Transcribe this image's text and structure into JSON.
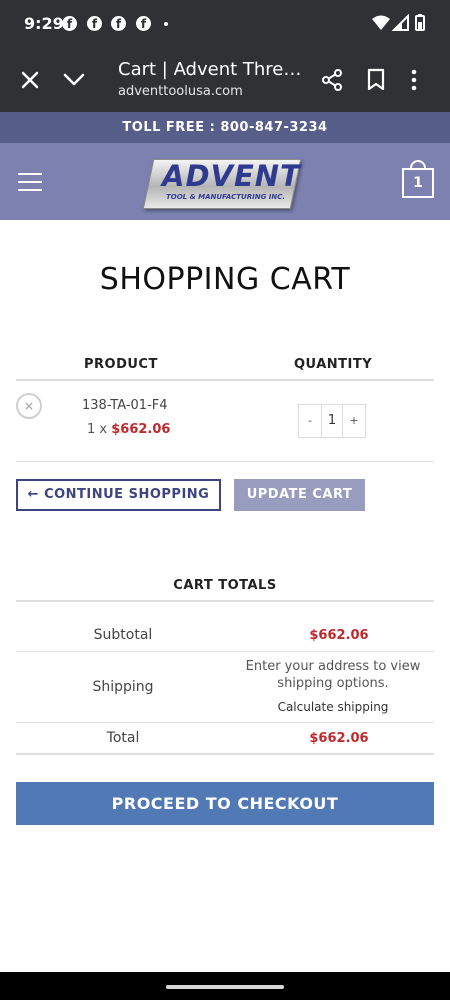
{
  "status_bar": {
    "time": "9:29",
    "notification_icons": [
      "facebook-icon",
      "facebook-icon",
      "facebook-icon",
      "facebook-icon"
    ],
    "system_icons": [
      "wifi-icon",
      "signal-icon",
      "battery-icon"
    ]
  },
  "browser": {
    "page_title": "Cart | Advent Thre…",
    "url": "adventtoolusa.com"
  },
  "site": {
    "toll_free": "TOLL FREE : 800-847-3234",
    "logo_word": "ADVENT",
    "logo_sub": "TOOL & MANUFACTURING INC.",
    "cart_count": "1"
  },
  "cart": {
    "title": "SHOPPING CART",
    "columns": {
      "product": "PRODUCT",
      "quantity": "QUANTITY"
    },
    "items": [
      {
        "remove": "×",
        "name": "138-TA-01-F4",
        "qty_prefix": "1 x ",
        "price": "$662.06",
        "qty": "1",
        "minus": "-",
        "plus": "+"
      }
    ],
    "continue_label": "← CONTINUE SHOPPING",
    "update_label": "UPDATE CART"
  },
  "totals": {
    "title": "CART TOTALS",
    "subtotal_label": "Subtotal",
    "subtotal_value": "$662.06",
    "shipping_label": "Shipping",
    "shipping_note": "Enter your address to view shipping options.",
    "calculate_shipping": "Calculate shipping",
    "total_label": "Total",
    "total_value": "$662.06"
  },
  "checkout_label": "PROCEED TO CHECKOUT",
  "colors": {
    "toll_bar": "#585e8a",
    "header": "#7c81b0",
    "accent_price": "#c0282d",
    "checkout": "#5079b5",
    "update_button": "#989cbe"
  }
}
